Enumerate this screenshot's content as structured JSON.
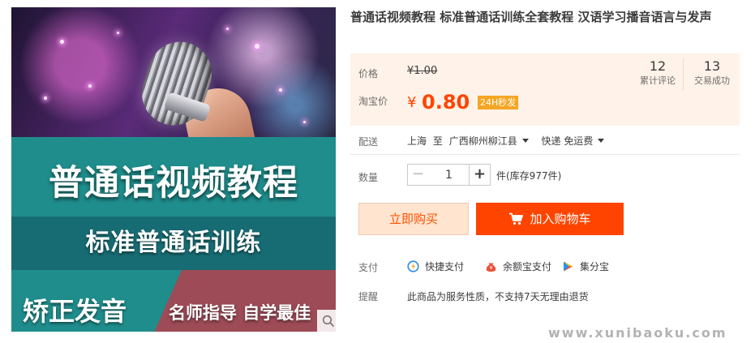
{
  "product": {
    "title": "普通话视频教程 标准普通话训练全套教程 汉语学习播音语言与发声",
    "image": {
      "headline": "普通话视频教程",
      "subheadline": "标准普通话训练",
      "tag_left": "矫正发音",
      "tag_right": "名师指导 自学最佳"
    }
  },
  "price": {
    "label": "价格",
    "original": "¥1.00",
    "taobao_label": "淘宝价",
    "currency": "¥",
    "current": "0.80",
    "badge": "24H秒发",
    "reviews_count": "12",
    "reviews_label": "累计评论",
    "sales_count": "13",
    "sales_label": "交易成功"
  },
  "shipping": {
    "label": "配送",
    "from": "上海",
    "to_word": "至",
    "destination": "广西柳州柳江县",
    "method": "快递 免运费"
  },
  "quantity": {
    "label": "数量",
    "minus": "−",
    "value": "1",
    "plus": "+",
    "stock": "件(库存977件)"
  },
  "actions": {
    "buy_now": "立即购买",
    "add_to_cart": "加入购物车"
  },
  "payment": {
    "label": "支付",
    "methods": [
      {
        "name": "快捷支付",
        "icon": "quickpay-icon"
      },
      {
        "name": "余额宝支付",
        "icon": "yuebao-icon"
      },
      {
        "name": "集分宝",
        "icon": "jifenbao-icon"
      }
    ]
  },
  "notice": {
    "label": "提醒",
    "text": "此商品为服务性质，不支持7天无理由退货"
  },
  "watermark": "www.xunibaoku.com",
  "colors": {
    "accent": "#ff4400",
    "price_bg": "#fff2e8",
    "buy_now_bg": "#ffe4d0",
    "badge": "#f5a623"
  }
}
